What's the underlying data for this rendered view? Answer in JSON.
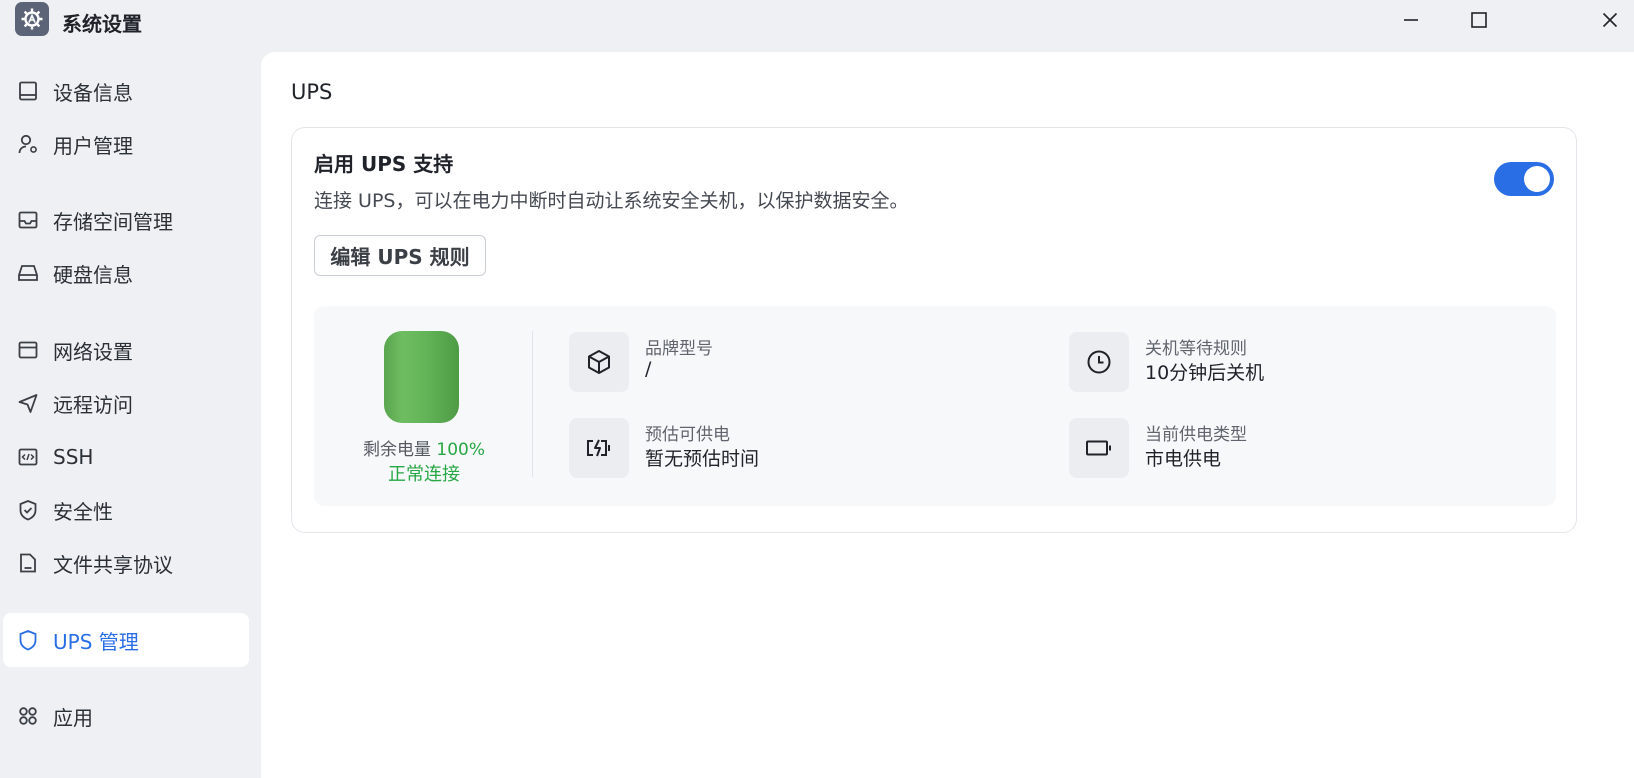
{
  "window": {
    "title": "系统设置",
    "app_icon": "gear-icon"
  },
  "window_controls": {
    "minimize": "minimize-icon",
    "maximize": "maximize-icon",
    "close": "close-icon"
  },
  "sidebar": {
    "items": [
      {
        "label": "设备信息",
        "icon": "device-icon",
        "active": false
      },
      {
        "label": "用户管理",
        "icon": "user-settings-icon",
        "active": false
      },
      {
        "label": "存储空间管理",
        "icon": "inbox-icon",
        "active": false
      },
      {
        "label": "硬盘信息",
        "icon": "harddisk-icon",
        "active": false
      },
      {
        "label": "网络设置",
        "icon": "network-icon",
        "active": false
      },
      {
        "label": "远程访问",
        "icon": "send-icon",
        "active": false
      },
      {
        "label": "SSH",
        "icon": "code-icon",
        "active": false
      },
      {
        "label": "安全性",
        "icon": "shield-check-icon",
        "active": false
      },
      {
        "label": "文件共享协议",
        "icon": "file-share-icon",
        "active": false
      },
      {
        "label": "UPS 管理",
        "icon": "shield-icon",
        "active": true
      },
      {
        "label": "应用",
        "icon": "apps-grid-icon",
        "active": false
      }
    ]
  },
  "main": {
    "title": "UPS",
    "card": {
      "title": "启用 UPS 支持",
      "description": "连接 UPS，可以在电力中断时自动让系统安全关机，以保护数据安全。",
      "toggle_on": true,
      "edit_button": "编辑 UPS 规则",
      "battery": {
        "label": "剩余电量",
        "percent_text": "100%",
        "level": 1.0,
        "status": "正常连接",
        "fill_color": "#63b458"
      },
      "info": [
        {
          "label": "品牌型号",
          "value": "/",
          "icon": "box-icon"
        },
        {
          "label": "关机等待规则",
          "value": "10分钟后关机",
          "icon": "clock-icon"
        },
        {
          "label": "预估可供电",
          "value": "暂无预估时间",
          "icon": "battery-charging-icon"
        },
        {
          "label": "当前供电类型",
          "value": "市电供电",
          "icon": "battery-outline-icon"
        }
      ]
    }
  },
  "colors": {
    "accent": "#2a6ee6",
    "success": "#28a745"
  }
}
